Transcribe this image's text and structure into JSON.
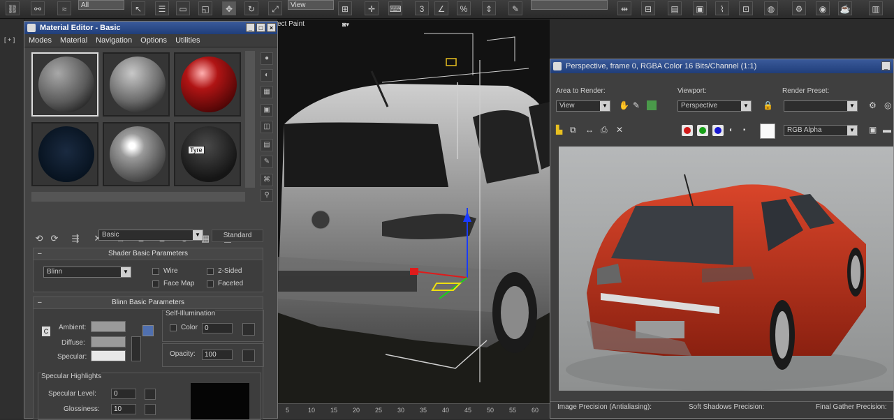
{
  "toolbar": {
    "selection_filter": "All",
    "view_dropdown": "View",
    "named_selection": ""
  },
  "viewport": {
    "label": "ect Paint",
    "timeline_ticks": [
      "5",
      "10",
      "15",
      "20",
      "25",
      "30",
      "35",
      "40",
      "45",
      "50",
      "55",
      "60"
    ]
  },
  "left_strip": {
    "label": "[ + ]"
  },
  "material_editor": {
    "title": "Material Editor - Basic",
    "menu": [
      "Modes",
      "Material",
      "Navigation",
      "Options",
      "Utilities"
    ],
    "tooltip": "Tyre",
    "material_name": "Basic",
    "material_type": "Standard",
    "shader_rollout": {
      "title": "Shader Basic Parameters",
      "shader": "Blinn",
      "wire": "Wire",
      "two_sided": "2-Sided",
      "face_map": "Face Map",
      "faceted": "Faceted"
    },
    "blinn_rollout": {
      "title": "Blinn Basic Parameters",
      "self_illum_group": "Self-Illumination",
      "color_label": "Color",
      "color_value": "0",
      "ambient": "Ambient:",
      "diffuse": "Diffuse:",
      "specular": "Specular:",
      "opacity_label": "Opacity:",
      "opacity_value": "100",
      "lock_c": "C"
    },
    "specular_highlights": {
      "title": "Specular Highlights",
      "level_label": "Specular Level:",
      "level_value": "0",
      "gloss_label": "Glossiness:",
      "gloss_value": "10"
    }
  },
  "render_frame": {
    "title": "Perspective, frame 0, RGBA Color 16 Bits/Channel (1:1)",
    "area_label": "Area to Render:",
    "area_value": "View",
    "viewport_label": "Viewport:",
    "viewport_value": "Perspective",
    "preset_label": "Render Preset:",
    "preset_value": "",
    "channel_value": "RGB Alpha",
    "bottom": {
      "image_precision": "Image Precision (Antialiasing):",
      "soft_shadows": "Soft Shadows Precision:",
      "final_gather": "Final Gather Precision:"
    }
  },
  "colors": {
    "title_bar": "#2a4a8a",
    "car_render": "#c0391f",
    "red_material": "#b01414",
    "swatch_ambient": "#9a9a9a",
    "swatch_specular": "#e8e8e8"
  }
}
